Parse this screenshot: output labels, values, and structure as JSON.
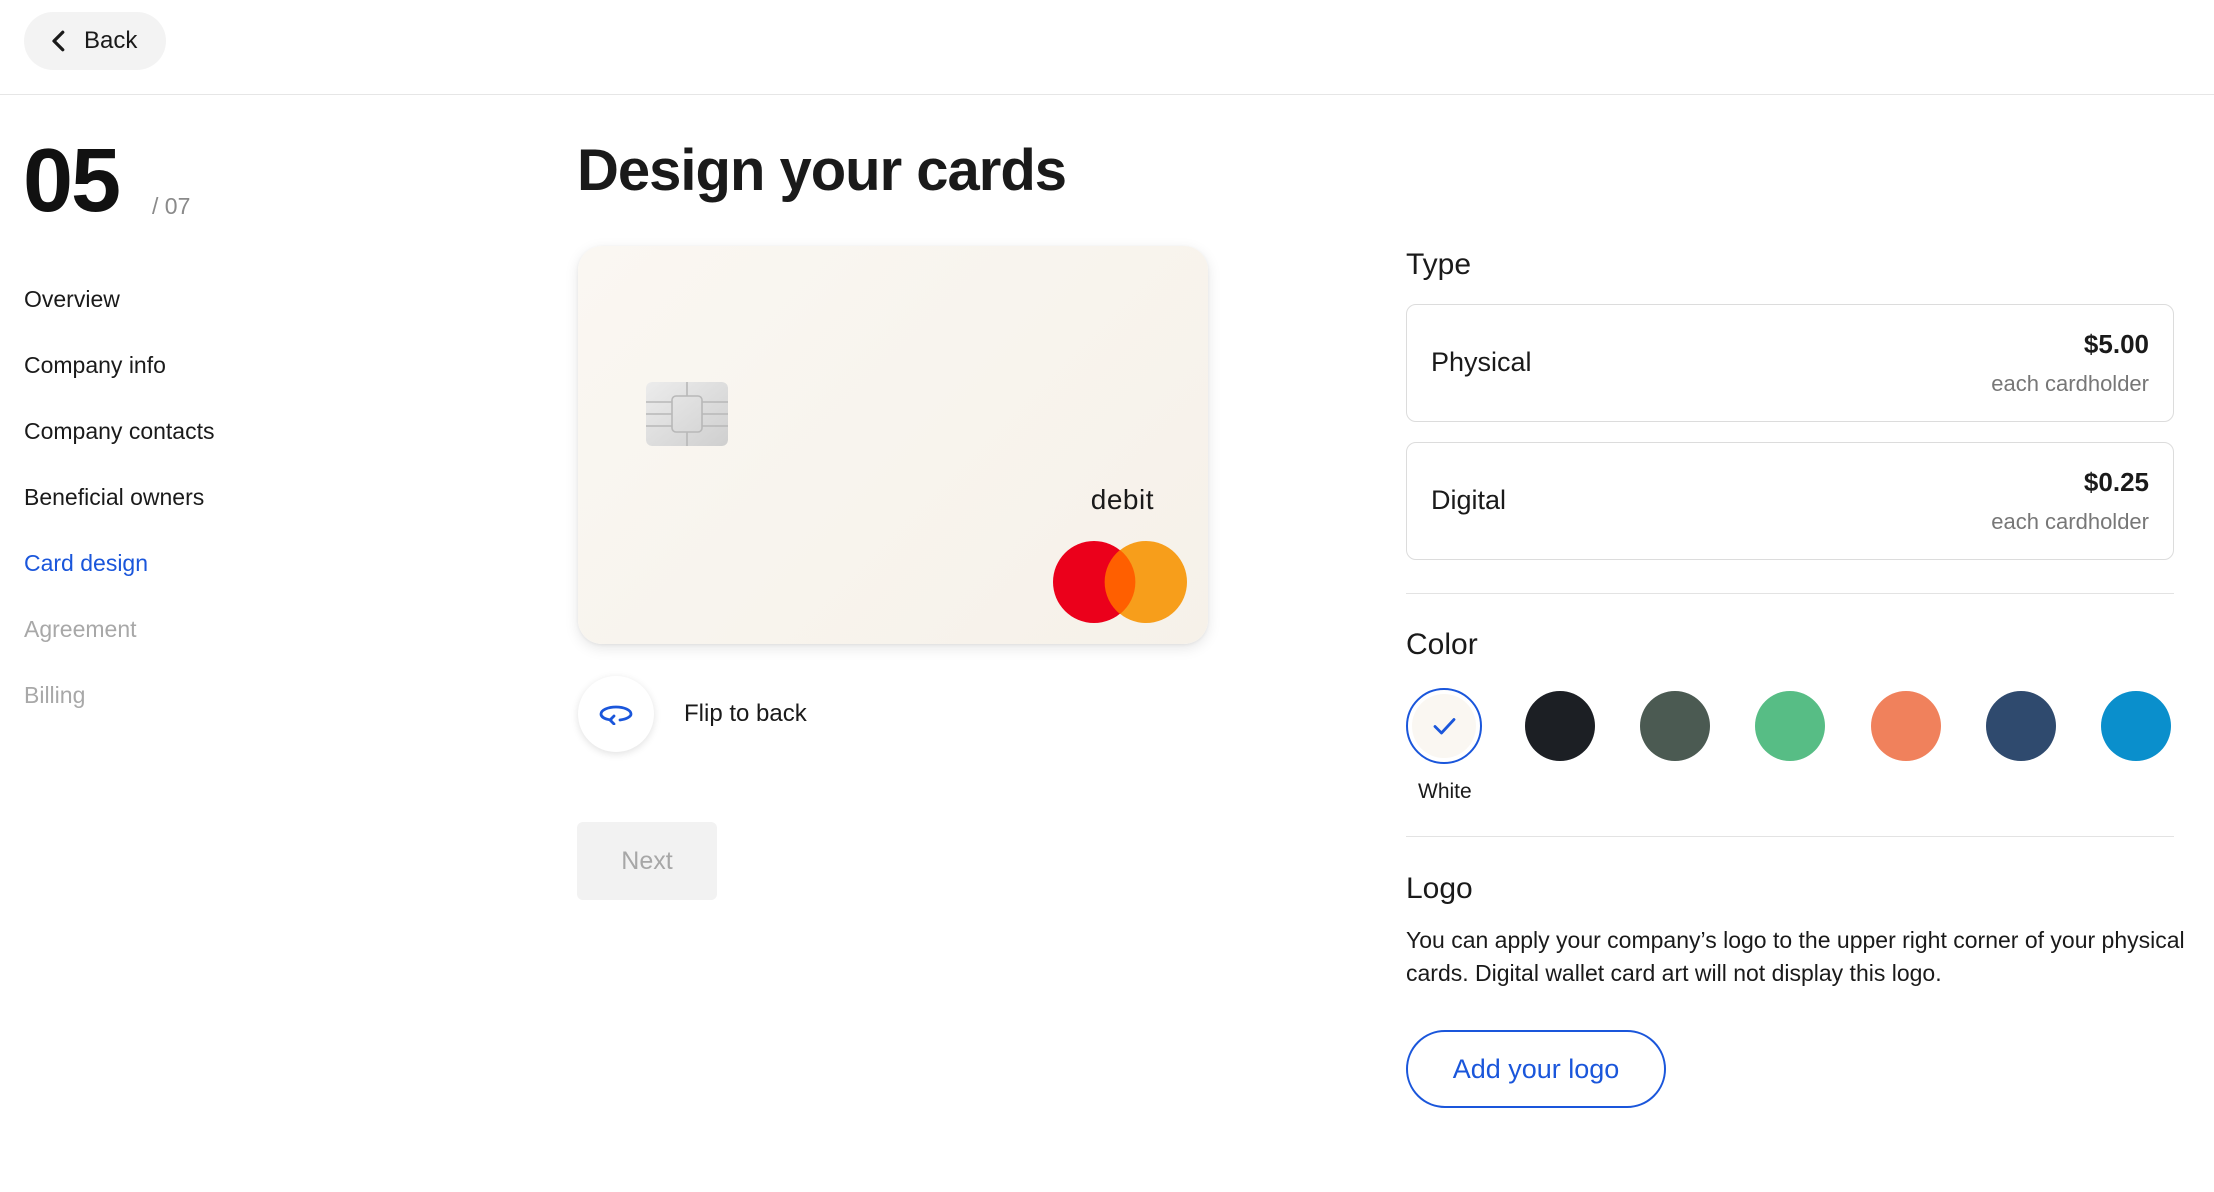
{
  "header": {
    "back_label": "Back"
  },
  "progress": {
    "current": "05",
    "total": "/ 07"
  },
  "nav": {
    "items": [
      {
        "label": "Overview",
        "state": "done"
      },
      {
        "label": "Company info",
        "state": "done"
      },
      {
        "label": "Company contacts",
        "state": "done"
      },
      {
        "label": "Beneficial owners",
        "state": "done"
      },
      {
        "label": "Card design",
        "state": "active"
      },
      {
        "label": "Agreement",
        "state": "upcoming"
      },
      {
        "label": "Billing",
        "state": "upcoming"
      }
    ]
  },
  "main": {
    "title": "Design your cards",
    "card_preview": {
      "network_label": "debit",
      "network_logo": "mastercard-logo"
    },
    "flip_label": "Flip to back",
    "next_label": "Next"
  },
  "options": {
    "type": {
      "heading": "Type",
      "choices": [
        {
          "name": "Physical",
          "price": "$5.00",
          "unit": "each cardholder"
        },
        {
          "name": "Digital",
          "price": "$0.25",
          "unit": "each cardholder"
        }
      ]
    },
    "color": {
      "heading": "Color",
      "selected_label": "White",
      "swatches": [
        {
          "hex": "#faf7f2",
          "selected": true
        },
        {
          "hex": "#1c1f24",
          "selected": false
        },
        {
          "hex": "#4b5a52",
          "selected": false
        },
        {
          "hex": "#57bd85",
          "selected": false
        },
        {
          "hex": "#f0815c",
          "selected": false
        },
        {
          "hex": "#2f4a6e",
          "selected": false
        },
        {
          "hex": "#0a8fcc",
          "selected": false
        }
      ]
    },
    "logo": {
      "heading": "Logo",
      "description": "You can apply your company’s logo to the upper right corner of your physical cards. Digital wallet card art will not display this logo.",
      "button_label": "Add your logo"
    }
  },
  "colors": {
    "accent": "#1a56db",
    "muted_text": "#a8a8a8"
  }
}
